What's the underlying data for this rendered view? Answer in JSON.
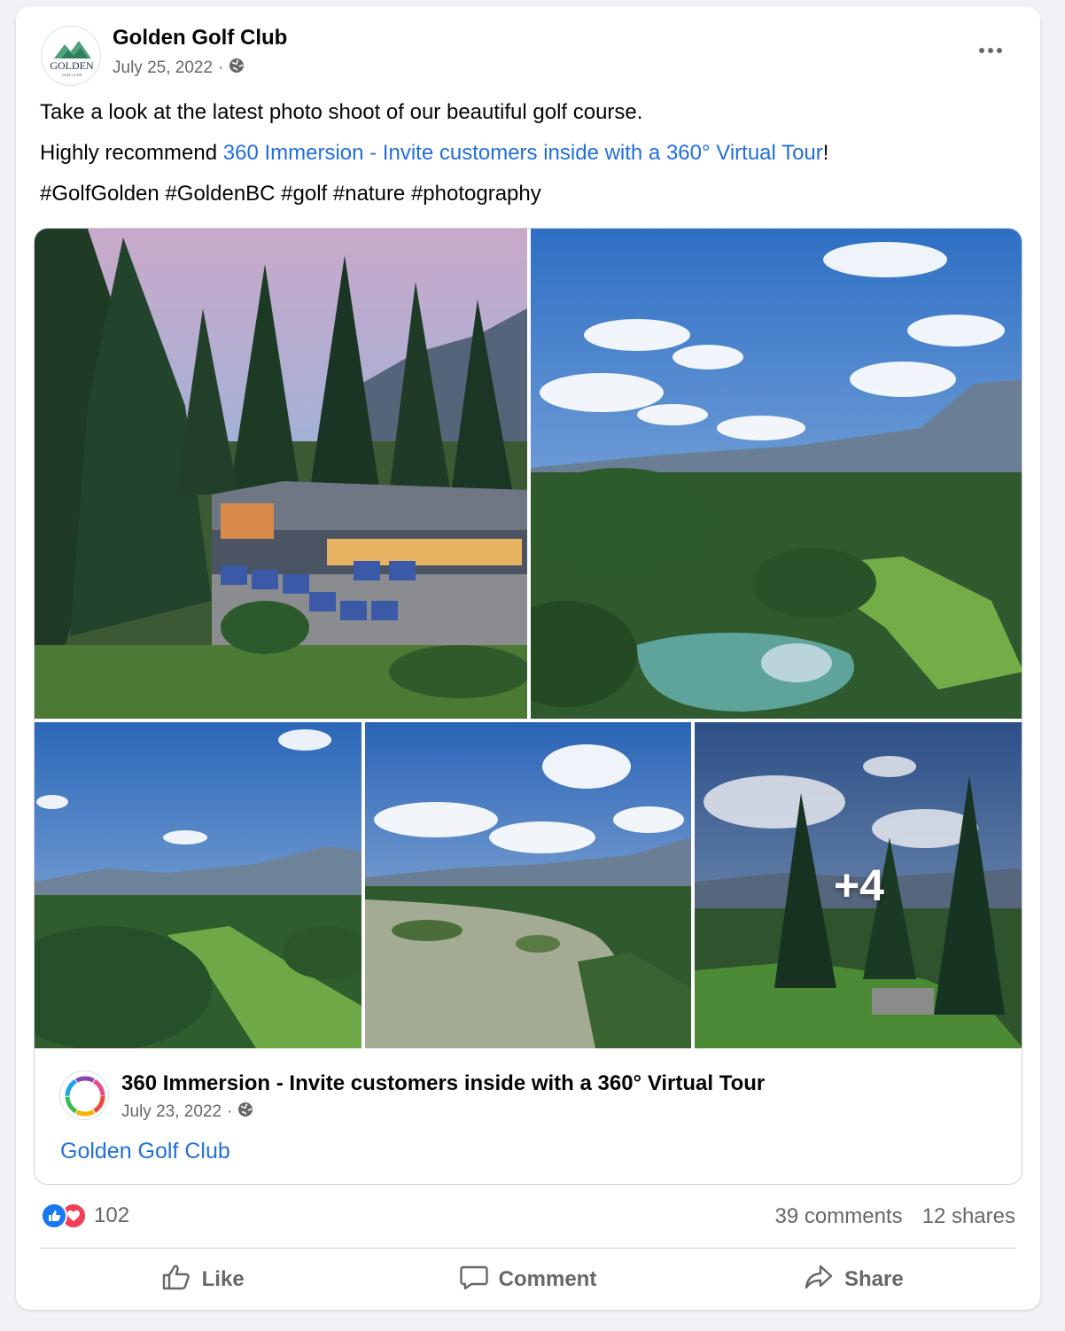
{
  "post": {
    "page_name": "Golden Golf Club",
    "avatar_text": "GOLDEN",
    "avatar_subtext": "GOLF CLUB",
    "date": "July 25, 2022",
    "separator": "·",
    "privacy_icon": "globe-icon",
    "line1": "Take a look at the latest photo shoot of our beautiful golf course.",
    "line2_prefix": "Highly recommend ",
    "line2_link": "360 Immersion - Invite customers inside with a 360° Virtual Tour",
    "line2_suffix": "!",
    "hashtags": "#GolfGolden #GoldenBC #golf #nature #photography"
  },
  "gallery": {
    "photos": [
      {
        "subject": "clubhouse with golf carts and pine trees at dusk"
      },
      {
        "subject": "aerial view of pond, fairway and mountains"
      },
      {
        "subject": "aerial view of fairway, forest and valley"
      },
      {
        "subject": "aerial view of river with islands"
      },
      {
        "subject": "tee box with cloudy sky and pines"
      }
    ],
    "more_count": "+4"
  },
  "shared_post": {
    "author": "360 Immersion - Invite customers inside with a 360° Virtual Tour",
    "date": "July 23, 2022",
    "separator": "·",
    "tag": "Golden Golf Club"
  },
  "engagement": {
    "reaction_count": "102",
    "comments": "39 comments",
    "shares": "12 shares"
  },
  "actions": {
    "like": "Like",
    "comment": "Comment",
    "share": "Share"
  },
  "colors": {
    "link": "#216fdb",
    "like_blue": "#1877f2",
    "love_red": "#f33e58",
    "meta_gray": "#65676b"
  }
}
